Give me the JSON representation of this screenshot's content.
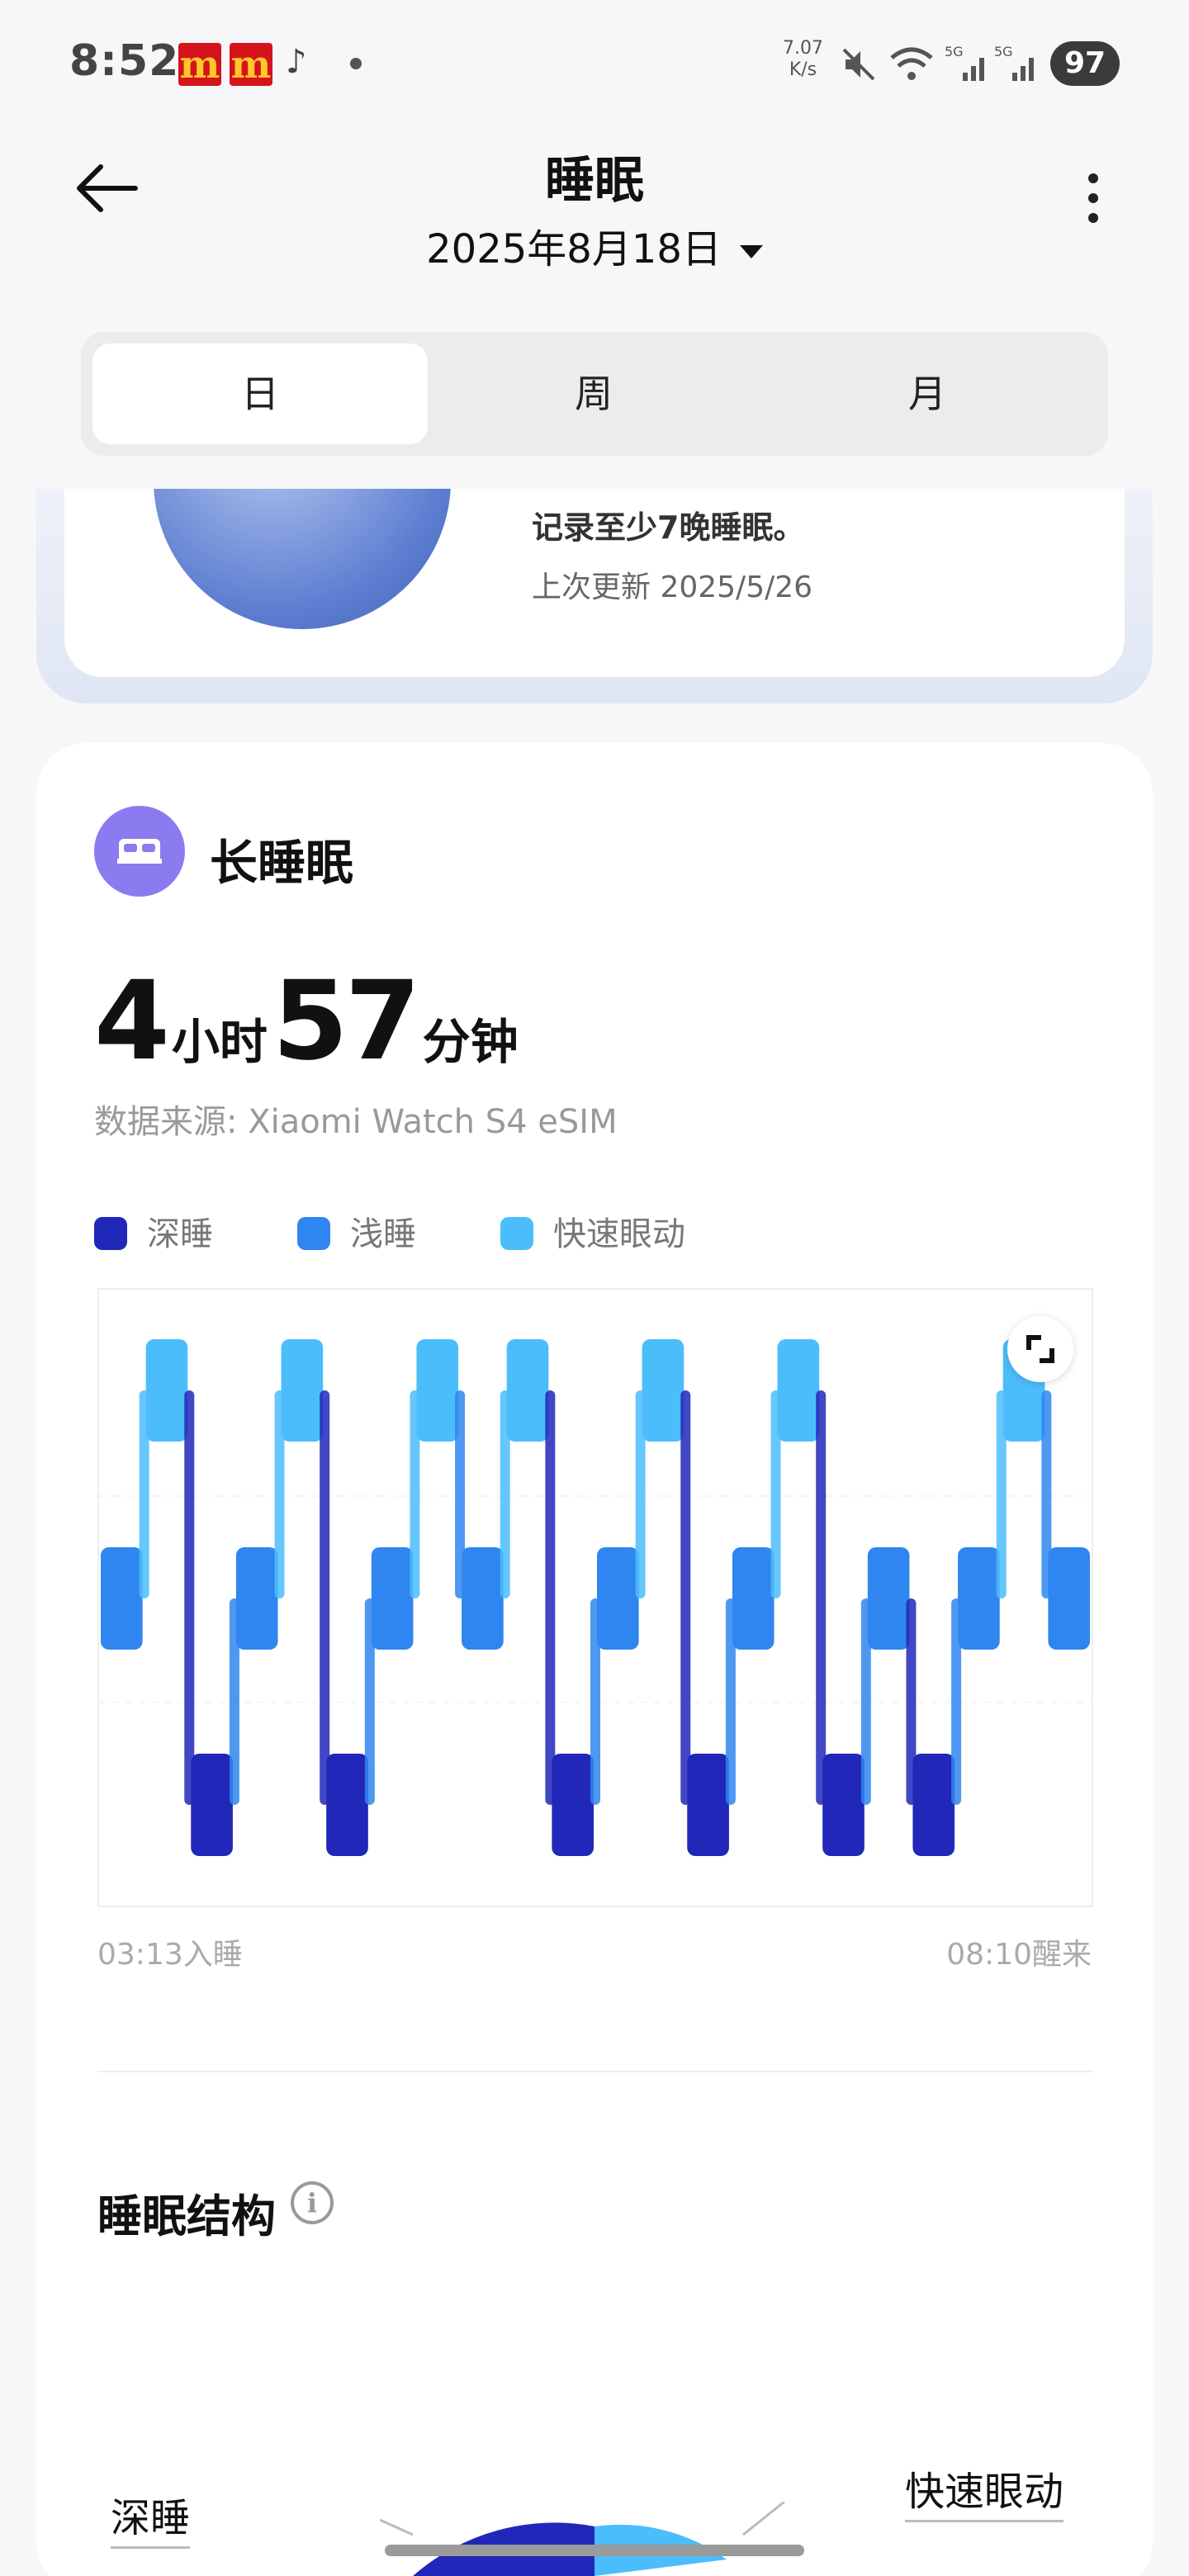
{
  "status_bar": {
    "time": "8:52",
    "net_speed_value": "7.07",
    "net_speed_unit": "K/s",
    "battery": "97",
    "icons": [
      "mcdonalds-icon",
      "mcdonalds-icon",
      "tiktok-icon",
      "mute-icon",
      "wifi-icon",
      "signal-5g-icon",
      "signal-5g-icon"
    ]
  },
  "header": {
    "title": "睡眠",
    "date": "2025年8月18日"
  },
  "tabs": [
    {
      "label": "日",
      "active": true
    },
    {
      "label": "周",
      "active": false
    },
    {
      "label": "月",
      "active": false
    }
  ],
  "top_card": {
    "line1": "记录至少7晚睡眠。",
    "line2": "上次更新 2025/5/26"
  },
  "sleep_card": {
    "title": "长睡眠",
    "hours": "4",
    "hours_unit": "小时",
    "minutes": "57",
    "minutes_unit": "分钟",
    "source": "数据来源: Xiaomi Watch S4 eSIM",
    "start_label": "03:13入睡",
    "end_label": "08:10醒来"
  },
  "colors": {
    "deep": "#2127b8",
    "light": "#2f86f0",
    "rem": "#4bbdfb"
  },
  "chart_data": {
    "type": "bar",
    "title": "",
    "legend": [
      "深睡",
      "浅睡",
      "快速眼动"
    ],
    "x_range": [
      "03:13",
      "08:10"
    ],
    "stage_levels": [
      "快速眼动",
      "浅睡",
      "深睡"
    ],
    "stages_sequence": [
      "浅睡",
      "快速眼动",
      "深睡",
      "浅睡",
      "快速眼动",
      "深睡",
      "浅睡",
      "快速眼动",
      "浅睡",
      "快速眼动",
      "深睡",
      "浅睡",
      "快速眼动",
      "深睡",
      "浅睡",
      "快速眼动",
      "深睡",
      "浅睡",
      "深睡",
      "浅睡",
      "快速眼动",
      "浅睡"
    ]
  },
  "structure": {
    "title": "睡眠结构",
    "label_deep": "深睡",
    "label_rem": "快速眼动"
  }
}
